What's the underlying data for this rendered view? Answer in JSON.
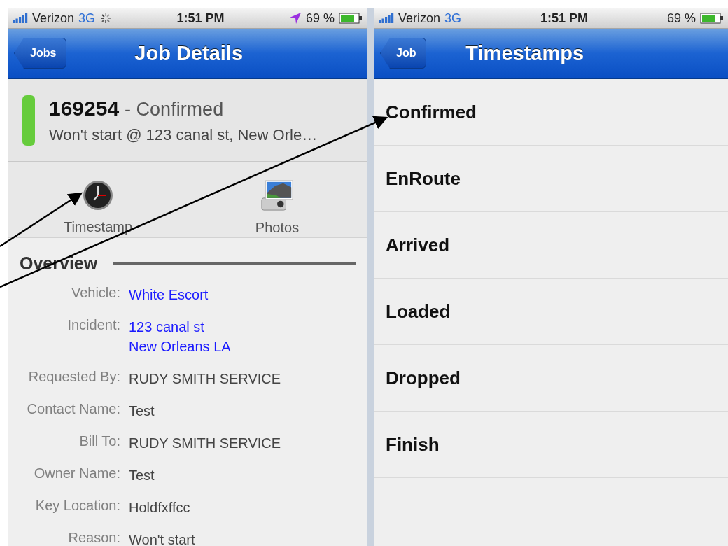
{
  "left_screen": {
    "status_bar": {
      "carrier": "Verizon",
      "network": "3G",
      "activity": true,
      "time": "1:51 PM",
      "location": true,
      "battery": "69 %"
    },
    "nav_bar": {
      "back": "Jobs",
      "title": "Job Details"
    },
    "job": {
      "number": "169254",
      "status": "- Confirmed",
      "color": "#66cc3c",
      "summary": "Won't start @ 123 canal st, New Orle…"
    },
    "actions": [
      {
        "label": "Timestamp",
        "kind": "clock"
      },
      {
        "label": "Photos",
        "kind": "photos"
      }
    ],
    "overview": {
      "title": "Overview",
      "rows": [
        {
          "label": "Vehicle:",
          "lines": [
            "White Escort"
          ],
          "kind": "link"
        },
        {
          "label": "Incident:",
          "lines": [
            "123 canal st",
            "New Orleans LA"
          ],
          "kind": "link"
        },
        {
          "label": "Requested By:",
          "lines": [
            "RUDY SMITH SERVICE"
          ],
          "kind": "text"
        },
        {
          "label": "Contact Name:",
          "lines": [
            "Test"
          ],
          "kind": "text"
        },
        {
          "label": "Bill To:",
          "lines": [
            "RUDY SMITH SERVICE"
          ],
          "kind": "text"
        },
        {
          "label": "Owner Name:",
          "lines": [
            "Test"
          ],
          "kind": "text"
        },
        {
          "label": "Key Location:",
          "lines": [
            "Holdfxffcc"
          ],
          "kind": "text"
        },
        {
          "label": "Reason:",
          "lines": [
            "Won't start"
          ],
          "kind": "text"
        }
      ]
    }
  },
  "right_screen": {
    "status_bar": {
      "carrier": "Verizon",
      "network": "3G",
      "activity": false,
      "time": "1:51 PM",
      "location": false,
      "battery": "69 %"
    },
    "nav_bar": {
      "back": "Job",
      "title": "Timestamps"
    },
    "items": [
      "Confirmed",
      "EnRoute",
      "Arrived",
      "Loaded",
      "Dropped",
      "Finish"
    ]
  }
}
